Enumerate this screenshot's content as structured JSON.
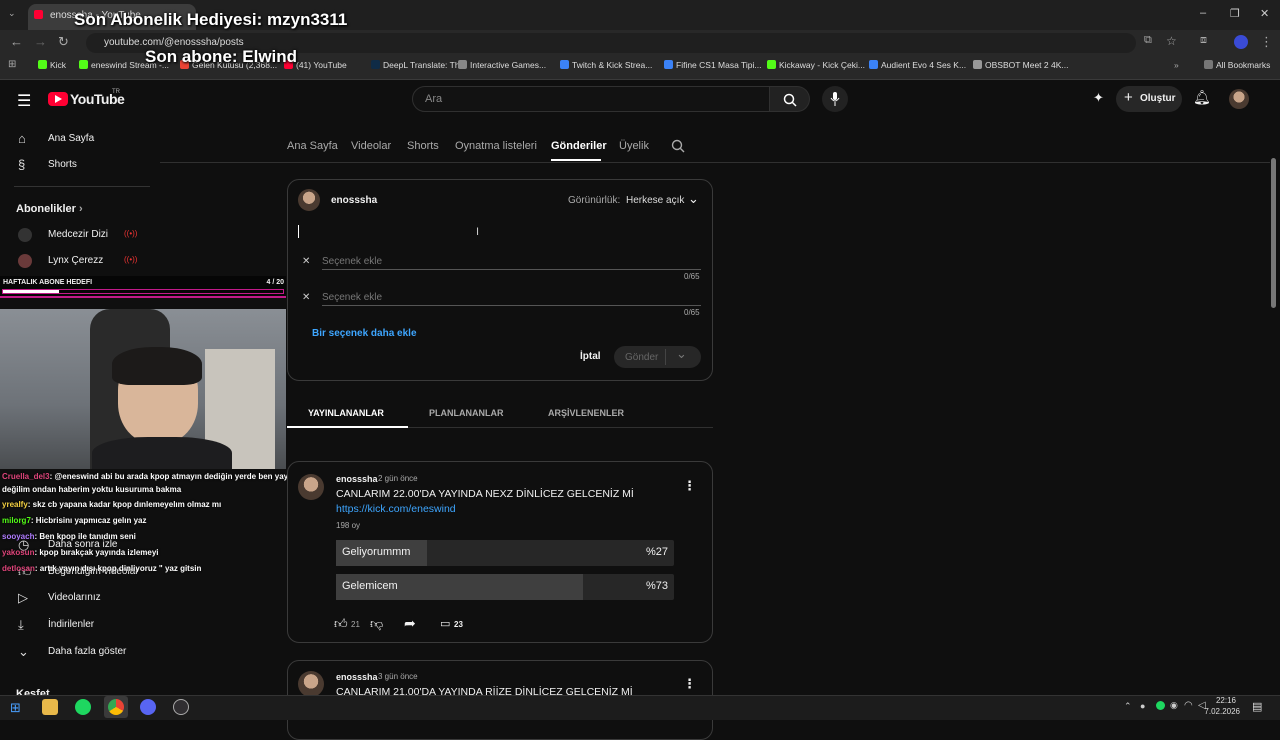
{
  "browser": {
    "tab_title": "enosssha - YouTube",
    "url": "youtube.com/@enosssha/posts",
    "bookmarks": [
      {
        "label": "Kick",
        "color": "#53fc18"
      },
      {
        "label": "eneswind Stream -...",
        "color": "#53fc18"
      },
      {
        "label": "Gelen Kutusu (2,368...",
        "color": "#ea4335"
      },
      {
        "label": "(41) YouTube",
        "color": "#ff0033"
      },
      {
        "label": "DeepL Translate: Th...",
        "color": "#0f2b46"
      },
      {
        "label": "Interactive Games...",
        "color": "#888888"
      },
      {
        "label": "Twitch & Kick Strea...",
        "color": "#3b82f6"
      },
      {
        "label": "Fifine CS1 Masa Tipi...",
        "color": "#3b82f6"
      },
      {
        "label": "Kickaway - Kick Çeki...",
        "color": "#53fc18"
      },
      {
        "label": "Audient Evo 4 Ses K...",
        "color": "#3b82f6"
      },
      {
        "label": "OBSBOT Meet 2 4K...",
        "color": "#999999"
      }
    ],
    "all_bookmarks": "All Bookmarks"
  },
  "overlay": {
    "gift": "Son Abonelik Hediyesi: mzyn3311",
    "last_sub": "Son abone: Elwind",
    "goal_label": "HAFTALIK ABONE HEDEFI",
    "goal_count": "4 / 20",
    "goal_progress": 0.2
  },
  "header": {
    "logo": "YouTube",
    "logo_sup": "TR",
    "search_placeholder": "Ara",
    "create_label": "Oluştur"
  },
  "sidebar": {
    "home": "Ana Sayfa",
    "shorts": "Shorts",
    "subscriptions": "Abonelikler",
    "subs": [
      "Medcezir Dizi",
      "Lynx Çerezz"
    ],
    "watch_later": "Daha sonra izle",
    "liked": "Beğendiğim videolar",
    "your_videos": "Videolarınız",
    "downloads": "İndirilenler",
    "show_more": "Daha fazla göster",
    "explore": "Keşfet"
  },
  "channel_tabs": [
    "Ana Sayfa",
    "Videolar",
    "Shorts",
    "Oynatma listeleri",
    "Gönderiler",
    "Üyelik"
  ],
  "composer": {
    "author": "enosssha",
    "visibility_label": "Görünürlük:",
    "visibility_value": "Herkese açık",
    "option_placeholder": "Seçenek ekle",
    "counter": "0/65",
    "add_option": "Bir seçenek daha ekle",
    "cancel": "İptal",
    "submit": "Gönder"
  },
  "post_tabs": [
    "YAYINLANANLAR",
    "PLANLANANLAR",
    "ARŞİVLENENLER"
  ],
  "posts": [
    {
      "author": "enosssha",
      "time": "2 gün önce",
      "text": "CANLARIM 22.00'DA YAYINDA NEXZ DİNLİCEZ GELCENİZ Mİ",
      "link": "https://kick.com/eneswind",
      "votes": "198 oy",
      "options": [
        {
          "label": "Geliyorummm",
          "pct": "%27",
          "fraction": 0.27
        },
        {
          "label": "Gelemicem",
          "pct": "%73",
          "fraction": 0.73
        }
      ],
      "likes": "21",
      "comments": "23"
    },
    {
      "author": "enosssha",
      "time": "3 gün önce",
      "text": "CANLARIM 21.00'DA YAYINDA RİİZE DİNLİCEZ GELCENİZ Mİ"
    }
  ],
  "chat": [
    {
      "user": "Cruella_del3",
      "color": "#e0457b",
      "msg": ": @eneswind abi bu arada kpop atmayın dediğin yerde ben yayında"
    },
    {
      "user": "",
      "color": "#ffffff",
      "msg": "değilim ondan haberim yoktu kusuruma bakma"
    },
    {
      "user": "yrealfy",
      "color": "#f5d142",
      "msg": ": skz cb yapana kadar kpop dınlemeyelım olmaz mı"
    },
    {
      "user": "milorg7",
      "color": "#53fc18",
      "msg": ": Hicbrisinı yapmıcaz gelın yaz"
    },
    {
      "user": "sooyach",
      "color": "#b07cff",
      "msg": ": Ben kpop ile tanıdım seni"
    },
    {
      "user": "yakosun",
      "color": "#e0457b",
      "msg": ": kpop bırakçak yayında izlemeyi"
    },
    {
      "user": "detlosan",
      "color": "#e0457b",
      "msg": ": artık yayın dışı kpop dinliyoruz \" yaz gitsin"
    }
  ],
  "taskbar": {
    "time": "22:16",
    "date": "7.02.2026"
  }
}
